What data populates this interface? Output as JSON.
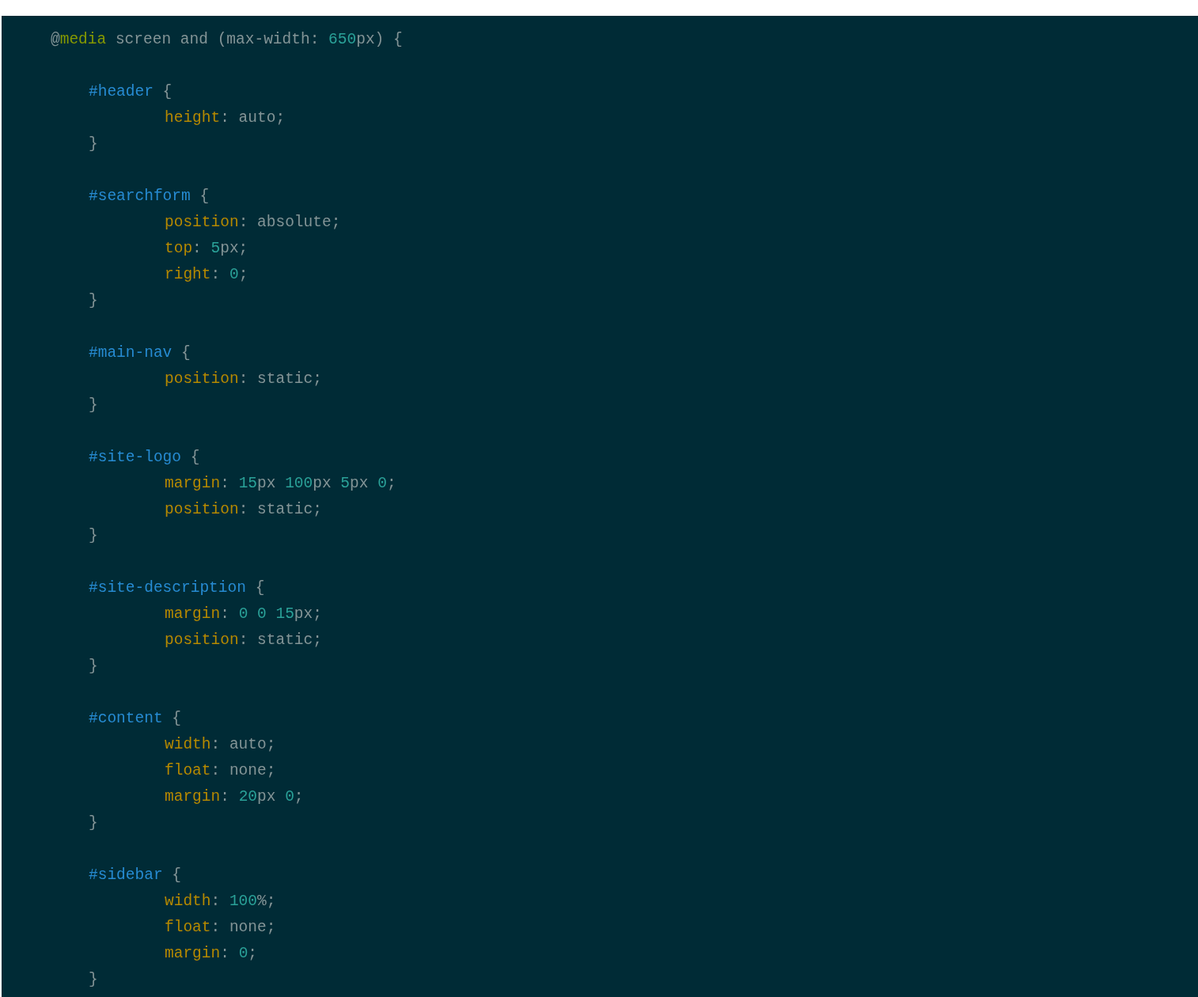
{
  "code": {
    "lines": [
      {
        "tokens": [
          {
            "kind": "plain",
            "text": "@"
          },
          {
            "kind": "keyword",
            "text": "media"
          },
          {
            "kind": "plain",
            "text": " screen and (max-width: "
          },
          {
            "kind": "number",
            "text": "650"
          },
          {
            "kind": "plain",
            "text": "px) "
          },
          {
            "kind": "brace",
            "text": "{"
          }
        ],
        "children": [
          {
            "tokens": [
              {
                "kind": "selector",
                "text": "#header"
              },
              {
                "kind": "brace",
                "text": " {"
              }
            ],
            "children": [
              {
                "tokens": [
                  {
                    "kind": "property",
                    "text": "height"
                  },
                  {
                    "kind": "plain",
                    "text": ": auto;"
                  }
                ]
              }
            ]
          },
          {
            "tokens": [
              {
                "kind": "brace",
                "text": "}"
              }
            ]
          },
          {
            "tokens": [
              {
                "kind": "selector",
                "text": "#searchform"
              },
              {
                "kind": "brace",
                "text": " {"
              }
            ],
            "children": [
              {
                "tokens": [
                  {
                    "kind": "property",
                    "text": "position"
                  },
                  {
                    "kind": "plain",
                    "text": ": absolute;"
                  }
                ]
              },
              {
                "tokens": [
                  {
                    "kind": "property",
                    "text": "top"
                  },
                  {
                    "kind": "plain",
                    "text": ": "
                  },
                  {
                    "kind": "number",
                    "text": "5"
                  },
                  {
                    "kind": "plain",
                    "text": "px;"
                  }
                ]
              },
              {
                "tokens": [
                  {
                    "kind": "property",
                    "text": "right"
                  },
                  {
                    "kind": "plain",
                    "text": ": "
                  },
                  {
                    "kind": "number",
                    "text": "0"
                  },
                  {
                    "kind": "plain",
                    "text": ";"
                  }
                ]
              }
            ]
          },
          {
            "tokens": [
              {
                "kind": "brace",
                "text": "}"
              }
            ]
          },
          {
            "tokens": [
              {
                "kind": "selector",
                "text": "#main-nav"
              },
              {
                "kind": "brace",
                "text": " {"
              }
            ],
            "children": [
              {
                "tokens": [
                  {
                    "kind": "property",
                    "text": "position"
                  },
                  {
                    "kind": "plain",
                    "text": ": static;"
                  }
                ]
              }
            ]
          },
          {
            "tokens": [
              {
                "kind": "brace",
                "text": "}"
              }
            ]
          },
          {
            "tokens": [
              {
                "kind": "selector",
                "text": "#site-logo"
              },
              {
                "kind": "brace",
                "text": " {"
              }
            ],
            "children": [
              {
                "tokens": [
                  {
                    "kind": "property",
                    "text": "margin"
                  },
                  {
                    "kind": "plain",
                    "text": ": "
                  },
                  {
                    "kind": "number",
                    "text": "15"
                  },
                  {
                    "kind": "plain",
                    "text": "px "
                  },
                  {
                    "kind": "number",
                    "text": "100"
                  },
                  {
                    "kind": "plain",
                    "text": "px "
                  },
                  {
                    "kind": "number",
                    "text": "5"
                  },
                  {
                    "kind": "plain",
                    "text": "px "
                  },
                  {
                    "kind": "number",
                    "text": "0"
                  },
                  {
                    "kind": "plain",
                    "text": ";"
                  }
                ]
              },
              {
                "tokens": [
                  {
                    "kind": "property",
                    "text": "position"
                  },
                  {
                    "kind": "plain",
                    "text": ": static;"
                  }
                ]
              }
            ]
          },
          {
            "tokens": [
              {
                "kind": "brace",
                "text": "}"
              }
            ]
          },
          {
            "tokens": [
              {
                "kind": "selector",
                "text": "#site-description"
              },
              {
                "kind": "brace",
                "text": " {"
              }
            ],
            "children": [
              {
                "tokens": [
                  {
                    "kind": "property",
                    "text": "margin"
                  },
                  {
                    "kind": "plain",
                    "text": ": "
                  },
                  {
                    "kind": "number",
                    "text": "0"
                  },
                  {
                    "kind": "number",
                    "text": " 0"
                  },
                  {
                    "kind": "number",
                    "text": " 15"
                  },
                  {
                    "kind": "plain",
                    "text": "px;"
                  }
                ]
              },
              {
                "tokens": [
                  {
                    "kind": "property",
                    "text": "position"
                  },
                  {
                    "kind": "plain",
                    "text": ": static;"
                  }
                ]
              }
            ]
          },
          {
            "tokens": [
              {
                "kind": "brace",
                "text": "}"
              }
            ]
          },
          {
            "tokens": [
              {
                "kind": "selector",
                "text": "#content"
              },
              {
                "kind": "brace",
                "text": " {"
              }
            ],
            "children": [
              {
                "tokens": [
                  {
                    "kind": "property",
                    "text": "width"
                  },
                  {
                    "kind": "plain",
                    "text": ": auto;"
                  }
                ]
              },
              {
                "tokens": [
                  {
                    "kind": "property",
                    "text": "float"
                  },
                  {
                    "kind": "plain",
                    "text": ": none;"
                  }
                ]
              },
              {
                "tokens": [
                  {
                    "kind": "property",
                    "text": "margin"
                  },
                  {
                    "kind": "plain",
                    "text": ": "
                  },
                  {
                    "kind": "number",
                    "text": "20"
                  },
                  {
                    "kind": "plain",
                    "text": "px "
                  },
                  {
                    "kind": "number",
                    "text": "0"
                  },
                  {
                    "kind": "plain",
                    "text": ";"
                  }
                ]
              }
            ]
          },
          {
            "tokens": [
              {
                "kind": "brace",
                "text": "}"
              }
            ]
          },
          {
            "tokens": [
              {
                "kind": "selector",
                "text": "#sidebar"
              },
              {
                "kind": "brace",
                "text": " {"
              }
            ],
            "children": [
              {
                "tokens": [
                  {
                    "kind": "property",
                    "text": "width"
                  },
                  {
                    "kind": "plain",
                    "text": ": "
                  },
                  {
                    "kind": "number",
                    "text": "100"
                  },
                  {
                    "kind": "plain",
                    "text": "%;"
                  }
                ]
              },
              {
                "tokens": [
                  {
                    "kind": "property",
                    "text": "float"
                  },
                  {
                    "kind": "plain",
                    "text": ": none;"
                  }
                ]
              },
              {
                "tokens": [
                  {
                    "kind": "property",
                    "text": "margin"
                  },
                  {
                    "kind": "plain",
                    "text": ": "
                  },
                  {
                    "kind": "number",
                    "text": "0"
                  },
                  {
                    "kind": "plain",
                    "text": ";"
                  }
                ]
              }
            ]
          },
          {
            "tokens": [
              {
                "kind": "brace",
                "text": "}"
              }
            ]
          }
        ]
      }
    ]
  }
}
